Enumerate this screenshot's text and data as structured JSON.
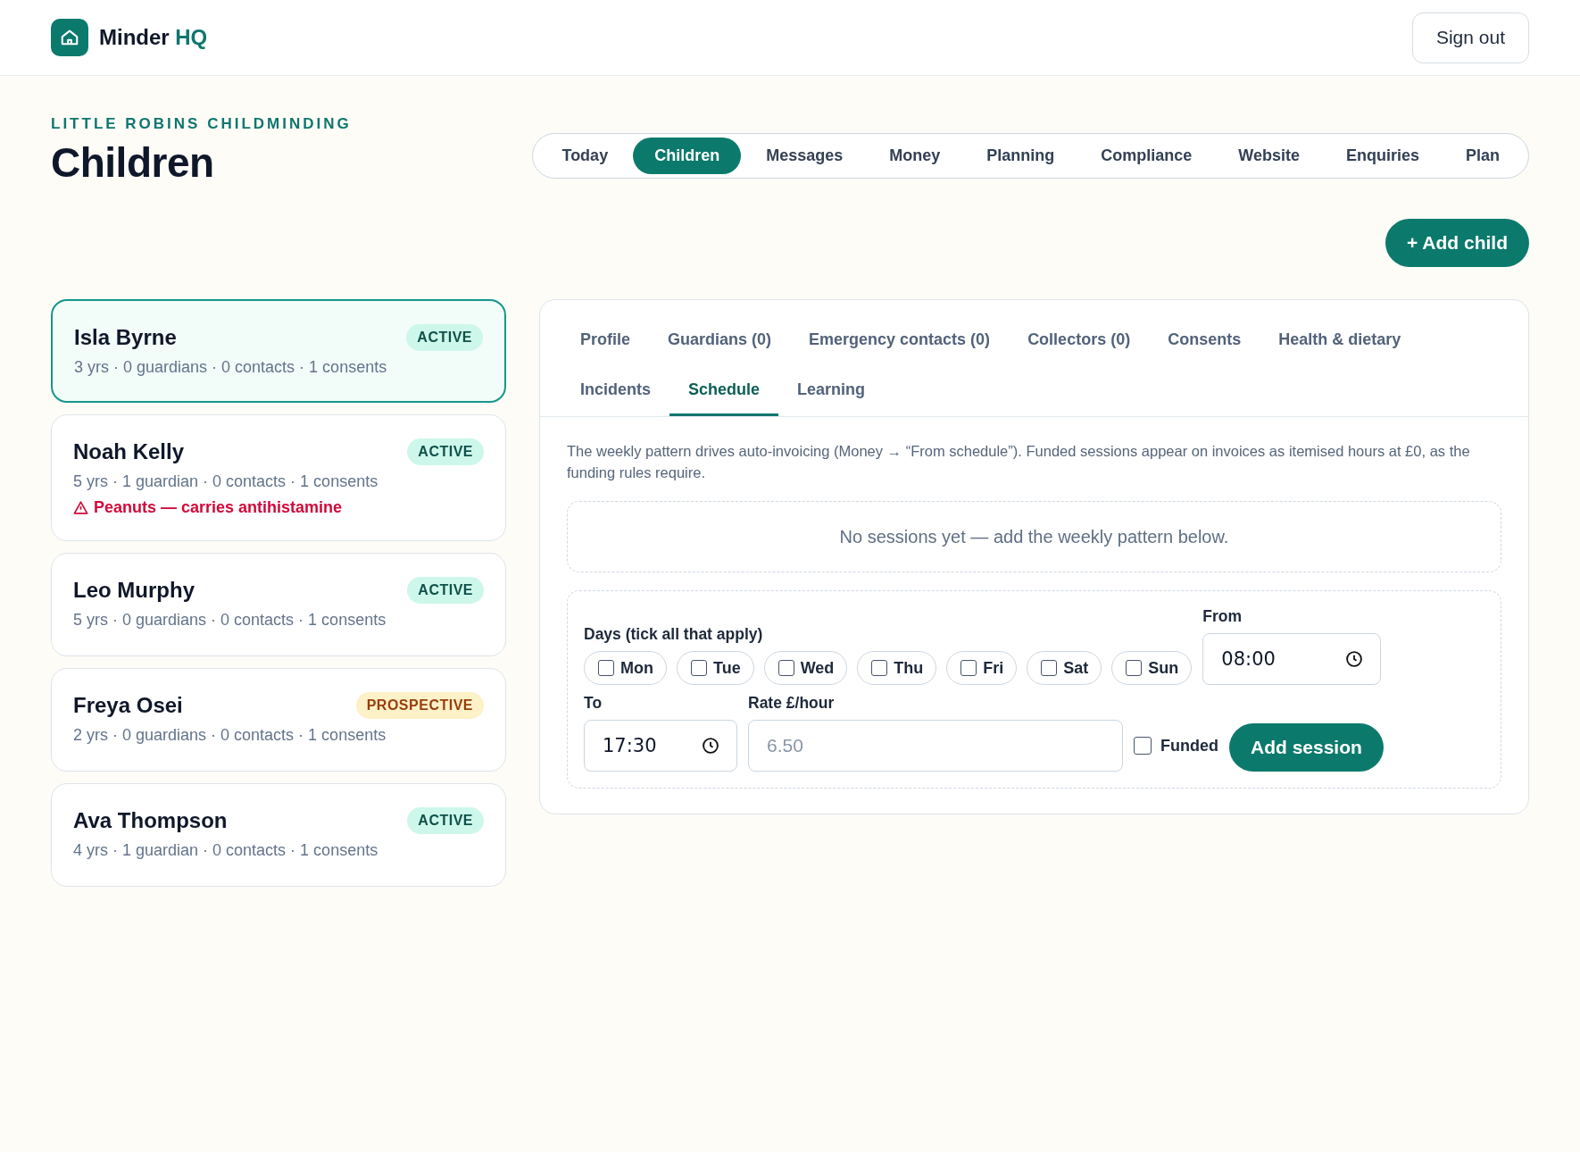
{
  "header": {
    "brand": "Minder",
    "brand_suffix": "HQ",
    "sign_out": "Sign out"
  },
  "page": {
    "eyebrow": "LITTLE ROBINS CHILDMINDING",
    "title": "Children"
  },
  "nav": [
    {
      "label": "Today",
      "selected": false
    },
    {
      "label": "Children",
      "selected": true
    },
    {
      "label": "Messages",
      "selected": false
    },
    {
      "label": "Money",
      "selected": false
    },
    {
      "label": "Planning",
      "selected": false
    },
    {
      "label": "Compliance",
      "selected": false
    },
    {
      "label": "Website",
      "selected": false
    },
    {
      "label": "Enquiries",
      "selected": false
    },
    {
      "label": "Plan",
      "selected": false
    }
  ],
  "add_child": "+ Add child",
  "children": [
    {
      "name": "Isla Byrne",
      "status": "ACTIVE",
      "kind": "active",
      "meta": "3 yrs · 0 guardians · 0 contacts · 1 consents",
      "selected": true
    },
    {
      "name": "Noah Kelly",
      "status": "ACTIVE",
      "kind": "active",
      "meta": "5 yrs · 1 guardian · 0 contacts · 1 consents",
      "alert": "Peanuts — carries antihistamine",
      "selected": false
    },
    {
      "name": "Leo Murphy",
      "status": "ACTIVE",
      "kind": "active",
      "meta": "5 yrs · 0 guardians · 0 contacts · 1 consents",
      "selected": false
    },
    {
      "name": "Freya Osei",
      "status": "PROSPECTIVE",
      "kind": "prospective",
      "meta": "2 yrs · 0 guardians · 0 contacts · 1 consents",
      "selected": false
    },
    {
      "name": "Ava Thompson",
      "status": "ACTIVE",
      "kind": "active",
      "meta": "4 yrs · 1 guardian · 0 contacts · 1 consents",
      "selected": false
    }
  ],
  "detail_tabs": [
    {
      "label": "Profile",
      "selected": false
    },
    {
      "label": "Guardians (0)",
      "selected": false
    },
    {
      "label": "Emergency contacts (0)",
      "selected": false
    },
    {
      "label": "Collectors (0)",
      "selected": false
    },
    {
      "label": "Consents",
      "selected": false
    },
    {
      "label": "Health & dietary",
      "selected": false
    },
    {
      "label": "Incidents",
      "selected": false
    },
    {
      "label": "Schedule",
      "selected": true
    },
    {
      "label": "Learning",
      "selected": false
    }
  ],
  "schedule": {
    "intro": "The weekly pattern drives auto-invoicing (Money → “From schedule”). Funded sessions appear on invoices as itemised hours at £0, as the funding rules require.",
    "empty": "No sessions yet — add the weekly pattern below.",
    "days_label": "Days (tick all that apply)",
    "days": [
      {
        "label": "Mon",
        "checked": false
      },
      {
        "label": "Tue",
        "checked": false
      },
      {
        "label": "Wed",
        "checked": false
      },
      {
        "label": "Thu",
        "checked": false
      },
      {
        "label": "Fri",
        "checked": false
      },
      {
        "label": "Sat",
        "checked": false
      },
      {
        "label": "Sun",
        "checked": false
      }
    ],
    "from": {
      "label": "From",
      "value": "08:00"
    },
    "to": {
      "label": "To",
      "value": "17:30"
    },
    "rate": {
      "label": "Rate £/hour",
      "placeholder": "6.50"
    },
    "funded": {
      "label": "Funded",
      "checked": false
    },
    "add_session": "Add session"
  }
}
